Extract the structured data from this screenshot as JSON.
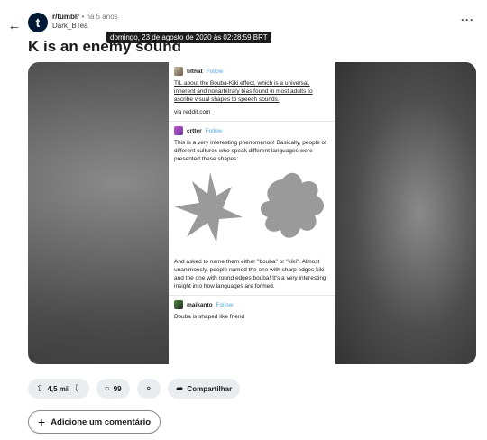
{
  "header": {
    "back_icon": "arrow-left-icon",
    "subreddit": "r/tumblr",
    "separator": "•",
    "age": "há 5 anos",
    "author": "Dark_BTea",
    "tooltip": "domingo, 23 de agosto de 2020 às 02:28:59 BRT",
    "more_icon": "ellipsis-icon",
    "avatar_letter": "t"
  },
  "post": {
    "title": "K is an enemy sound"
  },
  "tumblr": {
    "follow_label": "Follow",
    "posts": [
      {
        "username": "tilthat",
        "body": "TIL about the Bouba-Kiki effect, which is a universal, inherent and nonarbitrary bias found in most adults to ascribe visual shapes to speech sounds.",
        "via_prefix": "via ",
        "via_link": "reddit.com"
      },
      {
        "username": "crtter",
        "intro": "This is a very interesting phenomenon! Basically, people of different cultures who speak different languages were presented these shapes:",
        "outro": "And asked to name them either \"bouba\" or \"kiki\". Almost unanimously, people named the one with sharp edges kiki and the one with round edges bouba! It's a very interesting insight into how languages are formed."
      },
      {
        "username": "maikanto",
        "body": "Bouba is shaped like friend"
      }
    ]
  },
  "actions": {
    "vote_count": "4,5 mil",
    "comment_count": "99",
    "share_label": "Compartilhar",
    "add_comment_label": "Adicione um comentário"
  },
  "colors": {
    "accent_follow": "#4fa8e0",
    "pill_bg": "#eaedef",
    "subreddit_avatar": "#001935"
  }
}
